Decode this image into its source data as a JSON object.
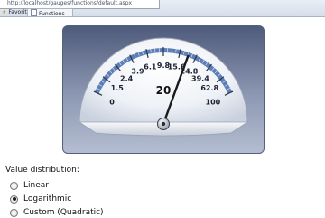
{
  "browser": {
    "url": "http://localhost/gauges/functions/default.aspx",
    "tabs": [
      {
        "label": "Favorites"
      },
      {
        "label": "Functions"
      }
    ]
  },
  "gauge": {
    "value": "20",
    "scale_labels": [
      "0",
      "1.5",
      "2.4",
      "3.9",
      "6.1",
      "9.8",
      "15.6",
      "24.8",
      "39.4",
      "62.8",
      "100"
    ],
    "needle_value": 20
  },
  "distribution": {
    "title": "Value distribution:",
    "options": [
      {
        "label": "Linear",
        "selected": false
      },
      {
        "label": "Logarithmic",
        "selected": true
      },
      {
        "label": "Custom (Quadratic)",
        "selected": false
      }
    ]
  },
  "colors": {
    "panel_top": "#4f5b7b",
    "scale_band": "#5d7fb8",
    "needle": "#1a1a1a"
  }
}
